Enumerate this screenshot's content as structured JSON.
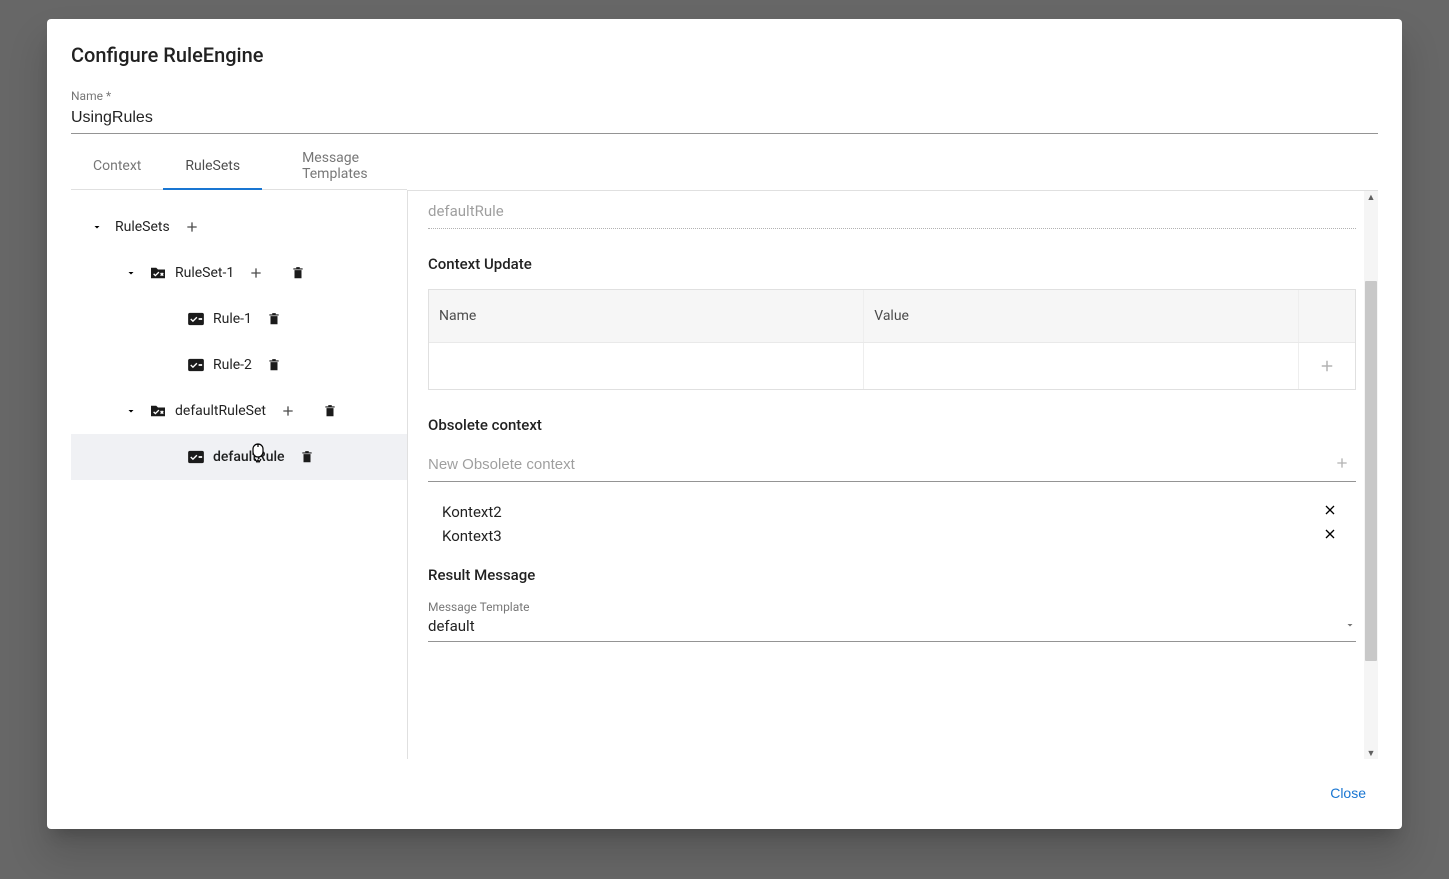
{
  "modal": {
    "title": "Configure RuleEngine",
    "nameLabel": "Name *",
    "nameValue": "UsingRules",
    "closeLabel": "Close"
  },
  "tabs": {
    "context": "Context",
    "rulesets": "RuleSets",
    "messageTemplates": "Message Templates"
  },
  "tree": {
    "root": "RuleSets",
    "ruleset1": "RuleSet-1",
    "rule1": "Rule-1",
    "rule2": "Rule-2",
    "defaultRuleset": "defaultRuleSet",
    "defaultRule": "defaultRule"
  },
  "detail": {
    "breadcrumb": "defaultRule",
    "contextUpdateTitle": "Context Update",
    "tableNameHeader": "Name",
    "tableValueHeader": "Value",
    "obsoleteTitle": "Obsolete context",
    "obsoletePlaceholder": "New Obsolete context",
    "obsoleteItems": [
      "Kontext2",
      "Kontext3"
    ],
    "resultMessageTitle": "Result Message",
    "messageTemplateLabel": "Message Template",
    "messageTemplateValue": "default"
  }
}
